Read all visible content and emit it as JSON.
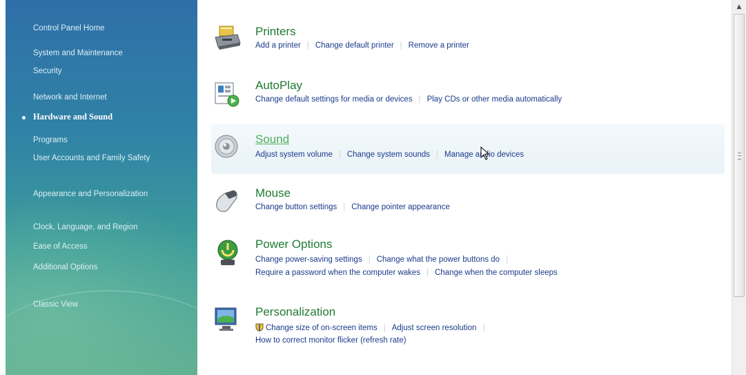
{
  "sidebar": {
    "home": "Control Panel Home",
    "items": [
      {
        "label": "System and Maintenance"
      },
      {
        "label": "Security"
      },
      {
        "label": "Network and Internet"
      },
      {
        "label": "Hardware and Sound",
        "active": true
      },
      {
        "label": "Programs"
      },
      {
        "label": "User Accounts and Family Safety"
      },
      {
        "label": "Appearance and Personalization"
      },
      {
        "label": "Clock, Language, and Region"
      },
      {
        "label": "Ease of Access"
      },
      {
        "label": "Additional Options"
      }
    ],
    "classic_view": "Classic View"
  },
  "categories": [
    {
      "title": "Printers",
      "icon": "printer-icon",
      "task_lines": [
        [
          "Add a printer",
          "Change default printer",
          "Remove a printer"
        ]
      ]
    },
    {
      "title": "AutoPlay",
      "icon": "autoplay-icon",
      "task_lines": [
        [
          "Change default settings for media or devices",
          "Play CDs or other media automatically"
        ]
      ]
    },
    {
      "title": "Sound",
      "icon": "speaker-icon",
      "hovered": true,
      "task_lines": [
        [
          "Adjust system volume",
          "Change system sounds",
          "Manage audio devices"
        ]
      ]
    },
    {
      "title": "Mouse",
      "icon": "mouse-icon",
      "task_lines": [
        [
          "Change button settings",
          "Change pointer appearance"
        ]
      ]
    },
    {
      "title": "Power Options",
      "icon": "power-options-icon",
      "task_lines": [
        [
          "Change power-saving settings",
          "Change what the power buttons do"
        ],
        [
          "Require a password when the computer wakes",
          "Change when the computer sleeps"
        ]
      ]
    },
    {
      "title": "Personalization",
      "icon": "display-icon",
      "task_lines": [
        [
          "Change size of on-screen items",
          "Adjust screen resolution"
        ],
        [
          "How to correct monitor flicker (refresh rate)"
        ]
      ]
    }
  ],
  "colors": {
    "category_title": "#1f7a32",
    "category_title_hover": "#4caf5c",
    "task_link": "#1a3a8a",
    "sidebar_top": "#2f6fa8",
    "sidebar_bottom": "#5fae92"
  }
}
